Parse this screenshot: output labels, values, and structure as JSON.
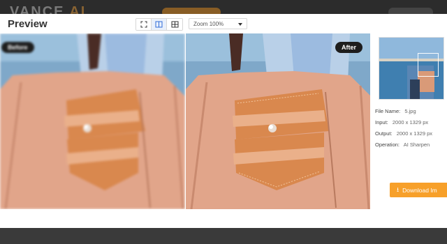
{
  "backdrop": {
    "brand": "VANCE",
    "brand_accent": "AI"
  },
  "modal": {
    "title": "Preview"
  },
  "view_toggle": {
    "options": [
      "fullscreen-icon",
      "split-view-icon",
      "grid-view-icon"
    ],
    "selected": "split-view-icon"
  },
  "zoom": {
    "label": "Zoom",
    "value": "100%"
  },
  "compare": {
    "before_label": "Before",
    "after_label": "After"
  },
  "info": {
    "file_name_key": "File Name:",
    "file_name": "5.jpg",
    "input_key": "Input:",
    "input": "2000 x 1329 px",
    "output_key": "Output:",
    "output": "2000 x 1329 px",
    "operation_key": "Operation:",
    "operation": "AI Sharpen"
  },
  "download": {
    "label": "Download Im",
    "icon": "download-icon"
  },
  "colors": {
    "accent": "#f7a02a",
    "label_bg": "#1d1d1d"
  }
}
